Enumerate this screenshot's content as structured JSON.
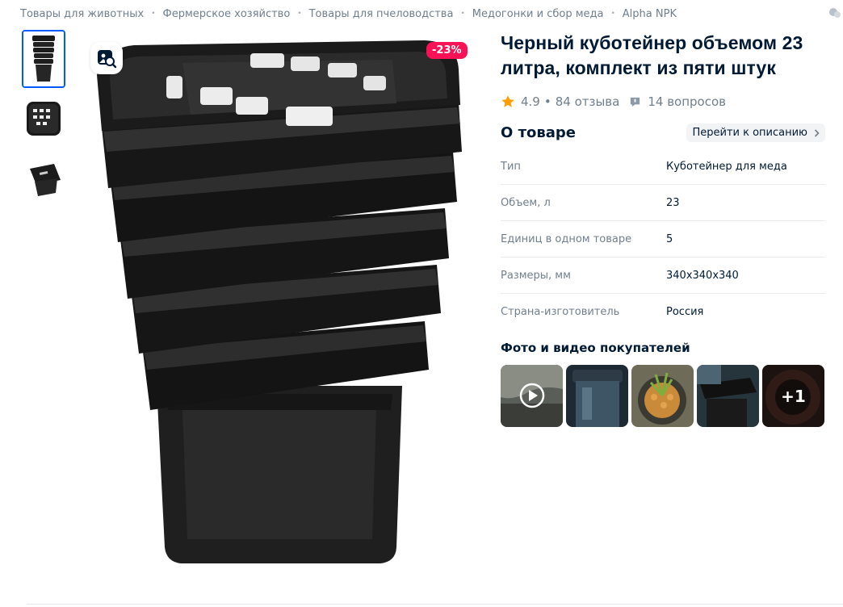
{
  "breadcrumbs": [
    "Товары для животных",
    "Фермерское хозяйство",
    "Товары для пчеловодства",
    "Медогонки и сбор меда",
    "Alpha NPK"
  ],
  "breadcrumb_separator": "•",
  "gallery": {
    "discount_badge": "-23%",
    "thumbnails": [
      "stack-front-thumb",
      "stack-top-thumb",
      "tilted-bucket-thumb"
    ]
  },
  "product": {
    "title": "Черный кубoтейнер объемом 23 литра, комплект из пяти штук",
    "rating": "4.9",
    "reviews": "84 отзыва",
    "questions": "14 вопросов",
    "rating_star_color": "#ff9e00"
  },
  "about": {
    "title": "О товаре",
    "goto_label": "Перейти к описанию",
    "properties": [
      {
        "key": "Тип",
        "value": "Кубoтейнер для меда"
      },
      {
        "key": "Объем, л",
        "value": "23"
      },
      {
        "key": "Единиц в одном товаре",
        "value": "5"
      },
      {
        "key": "Размеры, мм",
        "value": "340x340x340"
      },
      {
        "key": "Страна-изготовитель",
        "value": "Россия"
      }
    ]
  },
  "ugc": {
    "title": "Фото и видео покупателей",
    "more_label": "+1"
  },
  "colors": {
    "accent": "#005bff",
    "discount": "#f91155",
    "text_primary": "#001a34",
    "text_secondary": "#707f8d"
  }
}
